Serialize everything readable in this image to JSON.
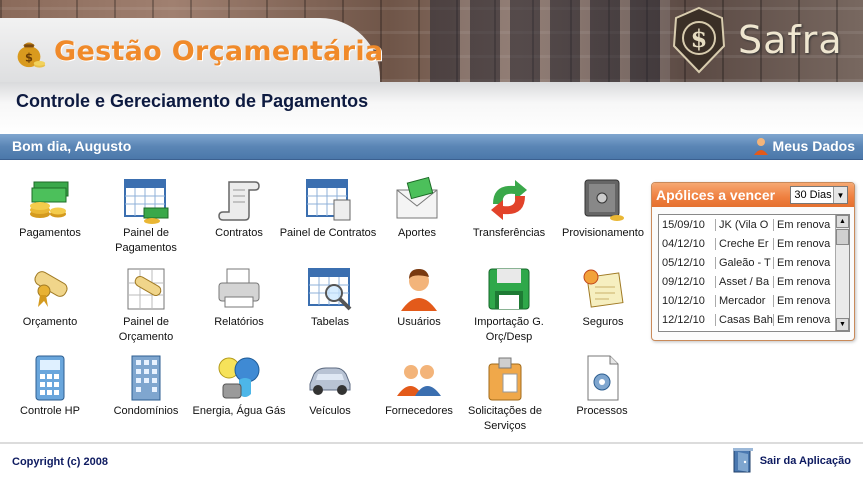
{
  "header": {
    "app_title": "Gestão Orçamentária",
    "brand_name": "Safra",
    "app_logo_icon": "money-bag-icon",
    "brand_seal_icon": "dollar-seal-icon"
  },
  "subtitle": "Controle e Gereciamento de Pagamentos",
  "greeting_bar": {
    "greeting": "Bom dia, Augusto",
    "my_data_label": "Meus Dados",
    "my_data_icon": "user-icon"
  },
  "modules": [
    {
      "label": "Pagamentos",
      "icon": "money-stack-icon"
    },
    {
      "label": "Painel de Pagamentos",
      "icon": "calendar-money-icon"
    },
    {
      "label": "Contratos",
      "icon": "scroll-icon"
    },
    {
      "label": "Painel de Contratos",
      "icon": "calendar-scroll-icon"
    },
    {
      "label": "Aportes",
      "icon": "envelope-money-icon"
    },
    {
      "label": "Transferências",
      "icon": "transfer-arrows-icon"
    },
    {
      "label": "Provisionamento",
      "icon": "safe-icon"
    },
    {
      "label": "Orçamento",
      "icon": "diploma-icon"
    },
    {
      "label": "Painel de Orçamento",
      "icon": "diploma-panel-icon"
    },
    {
      "label": "Relatórios",
      "icon": "printer-icon"
    },
    {
      "label": "Tabelas",
      "icon": "table-search-icon"
    },
    {
      "label": "Usuários",
      "icon": "user-icon"
    },
    {
      "label": "Importação G. Orç/Desp",
      "icon": "floppy-disk-icon"
    },
    {
      "label": "Seguros",
      "icon": "certificate-icon"
    },
    {
      "label": "Controle HP",
      "icon": "calculator-icon"
    },
    {
      "label": "Condomínios",
      "icon": "building-icon"
    },
    {
      "label": "Energia, Água Gás",
      "icon": "energy-icon"
    },
    {
      "label": "Veículos",
      "icon": "car-icon"
    },
    {
      "label": "Fornecedores",
      "icon": "people-icon"
    },
    {
      "label": "Solicitações de Serviços",
      "icon": "clipboard-icon"
    },
    {
      "label": "Processos",
      "icon": "document-gear-icon"
    }
  ],
  "policies_panel": {
    "title": "Apólices a vencer",
    "period_selected": "30 Dias",
    "rows": [
      {
        "date": "15/09/10",
        "name": "JK (Vila O",
        "status": "Em renova"
      },
      {
        "date": "04/12/10",
        "name": "Creche Er",
        "status": "Em renova"
      },
      {
        "date": "05/12/10",
        "name": "Galeão - T",
        "status": "Em renova"
      },
      {
        "date": "09/12/10",
        "name": "Asset / Ba",
        "status": "Em renova"
      },
      {
        "date": "10/12/10",
        "name": "Mercador",
        "status": "Em renova"
      },
      {
        "date": "12/12/10",
        "name": "Casas Bah",
        "status": "Em renova"
      }
    ]
  },
  "footer": {
    "copyright": "Copyright (c) 2008",
    "logout_label": "Sair da Aplicação",
    "logout_icon": "exit-door-icon"
  },
  "colors": {
    "title_orange": "#f08a2a",
    "bar_blue": "#5a85b5",
    "panel_orange": "#ef7f3f",
    "text_navy": "#0d1a40"
  }
}
